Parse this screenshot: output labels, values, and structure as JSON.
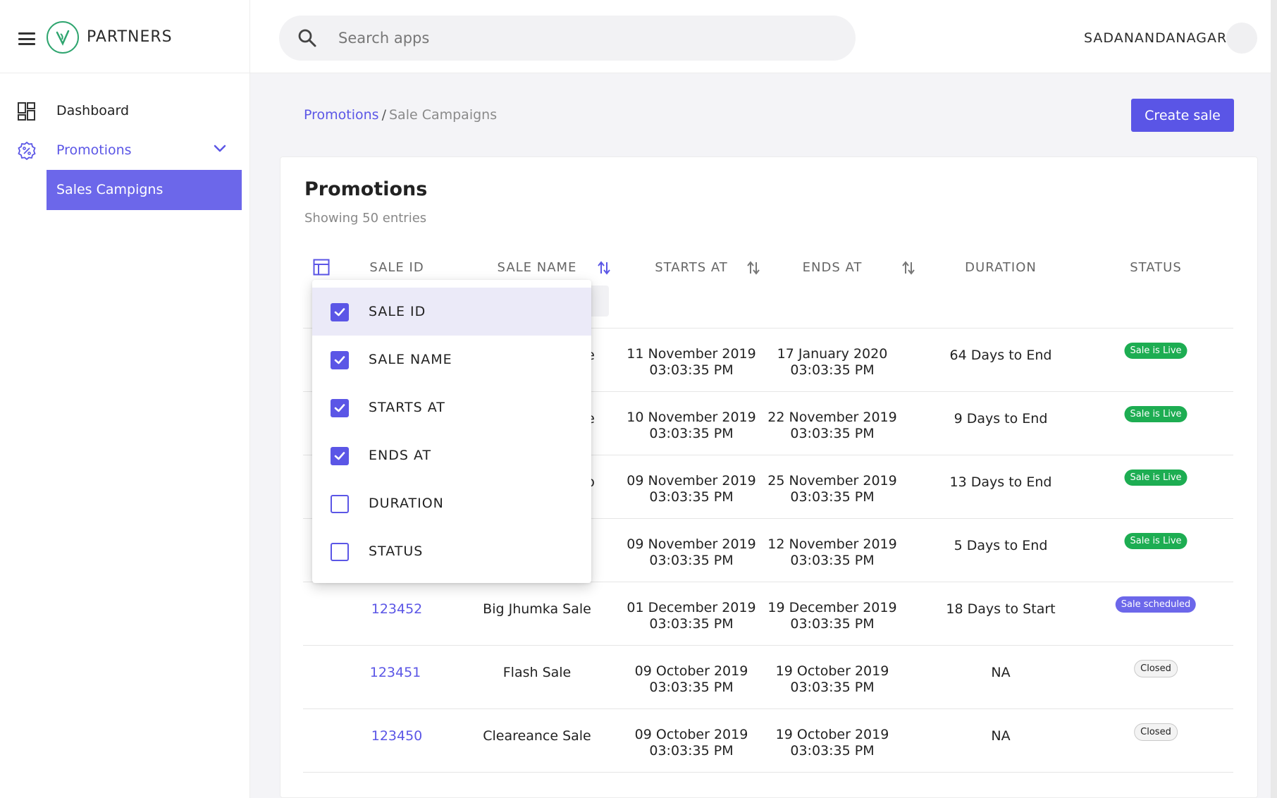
{
  "header": {
    "brand": "PARTNERS",
    "search_placeholder": "Search apps",
    "username": "SADANANDANAGAR"
  },
  "sidebar": {
    "items": [
      {
        "label": "Dashboard",
        "icon": "dashboard-grid-icon"
      },
      {
        "label": "Promotions",
        "icon": "percent-badge-icon"
      }
    ],
    "subitems": [
      {
        "label": "Sales Campigns"
      }
    ]
  },
  "breadcrumb": {
    "parent": "Promotions",
    "sep": "/",
    "current": "Sale Campaigns"
  },
  "actions": {
    "create": "Create sale"
  },
  "card": {
    "title": "Promotions",
    "subtitle": "Showing 50 entries"
  },
  "table": {
    "columns": [
      "SALE ID",
      "SALE NAME",
      "STARTS AT",
      "ENDS AT",
      "DURATION",
      "STATUS"
    ],
    "rows": [
      {
        "id": "",
        "name_partial": "e",
        "start_date": "11 November 2019",
        "start_time": "03:03:35 PM",
        "end_date": "17 January 2020",
        "end_time": "03:03:35 PM",
        "duration": "64 Days to End",
        "status": "Sale is Live"
      },
      {
        "id": "",
        "name_partial": "e",
        "start_date": "10 November 2019",
        "start_time": "03:03:35 PM",
        "end_date": "22 November 2019",
        "end_time": "03:03:35 PM",
        "duration": "9 Days to End",
        "status": "Sale is Live"
      },
      {
        "id": "",
        "name_partial": "o",
        "start_date": "09 November 2019",
        "start_time": "03:03:35 PM",
        "end_date": "25 November 2019",
        "end_time": "03:03:35 PM",
        "duration": "13 Days to End",
        "status": "Sale is Live"
      },
      {
        "id": "",
        "name_partial": "",
        "start_date": "09 November 2019",
        "start_time": "03:03:35 PM",
        "end_date": "12 November 2019",
        "end_time": "03:03:35 PM",
        "duration": "5 Days to End",
        "status": "Sale is Live"
      },
      {
        "id": "123452",
        "name": "Big Jhumka Sale",
        "start_date": "01 December 2019",
        "start_time": "03:03:35 PM",
        "end_date": "19 December 2019",
        "end_time": "03:03:35 PM",
        "duration": "18 Days to Start",
        "status": "Sale scheduled"
      },
      {
        "id": "123451",
        "name": "Flash Sale",
        "start_date": "09 October 2019",
        "start_time": "03:03:35 PM",
        "end_date": "19 October 2019",
        "end_time": "03:03:35 PM",
        "duration": "NA",
        "status": "Closed"
      },
      {
        "id": "123450",
        "name": "Cleareance Sale",
        "start_date": "09 October 2019",
        "start_time": "03:03:35 PM",
        "end_date": "19 October 2019",
        "end_time": "03:03:35 PM",
        "duration": "NA",
        "status": "Closed"
      }
    ]
  },
  "column_menu": {
    "items": [
      {
        "label": "SALE ID",
        "checked": true
      },
      {
        "label": "SALE NAME",
        "checked": true
      },
      {
        "label": "STARTS AT",
        "checked": true
      },
      {
        "label": "ENDS AT",
        "checked": true
      },
      {
        "label": "DURATION",
        "checked": false
      },
      {
        "label": "STATUS",
        "checked": false
      }
    ]
  },
  "colors": {
    "accent": "#5b56e6",
    "live": "#1dad52",
    "scheduled": "#6c67ea",
    "brand_green": "#2fa56f"
  }
}
